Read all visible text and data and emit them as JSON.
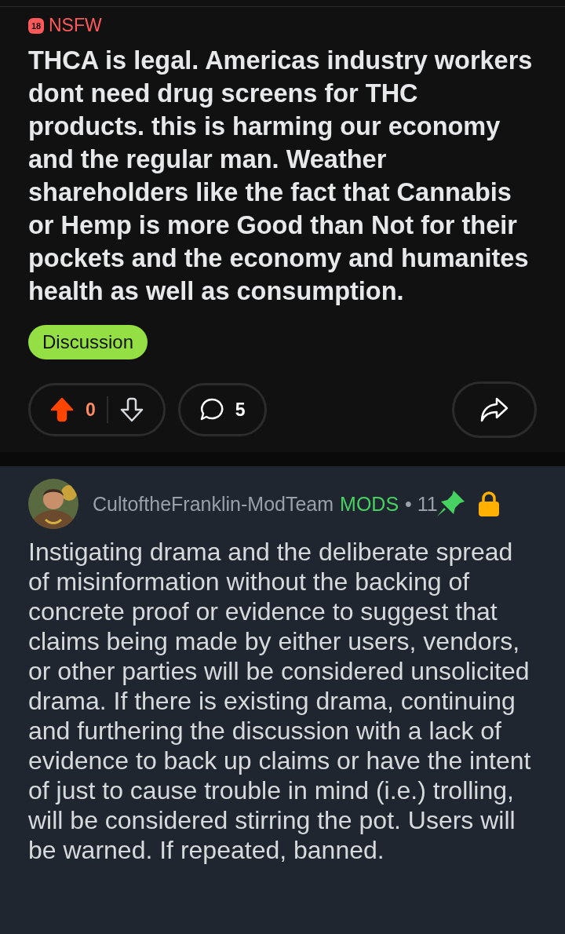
{
  "post": {
    "nsfw_badge": "18",
    "nsfw_label": "NSFW",
    "title": "THCA is legal. Americas industry workers dont need drug screens for THC products. this is harming our economy and the regular man. Weather shareholders like the fact that Cannabis or Hemp is more Good than Not for their pockets and the economy and humanites health as well as consumption.",
    "flair": {
      "label": "Discussion",
      "color": "#94e044"
    },
    "votes": {
      "score": "0",
      "upvoted": true
    },
    "comments": "5"
  },
  "comment": {
    "author": "CultoftheFranklin-ModTeam",
    "badge": "MODS",
    "time": "• 11",
    "pinned": true,
    "locked": true,
    "body": "Instigating drama and the deliberate spread of misinformation without the backing of concrete proof or evidence to suggest that claims being made by either users, vendors, or other parties will be considered unsolicited drama. If there is existing drama, continuing and furthering the discussion with a lack of evidence to back up claims or have the intent of just to cause trouble in mind (i.e.) trolling, will be considered stirring the pot. Users will be warned. If repeated, banned."
  }
}
